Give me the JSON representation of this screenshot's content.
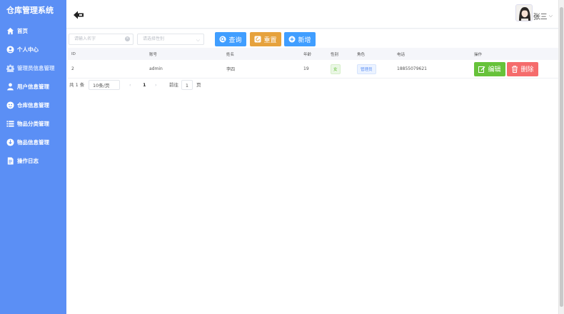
{
  "app": {
    "title": "仓库管理系统"
  },
  "sidebar": {
    "items": [
      {
        "label": "首页",
        "icon": "home-icon"
      },
      {
        "label": "个人中心",
        "icon": "user-circle-icon"
      },
      {
        "label": "管理员信息管理",
        "icon": "gear-icon"
      },
      {
        "label": "用户信息管理",
        "icon": "users-icon"
      },
      {
        "label": "仓库信息管理",
        "icon": "warehouse-icon"
      },
      {
        "label": "物品分类管理",
        "icon": "list-icon"
      },
      {
        "label": "物品信息管理",
        "icon": "box-icon"
      },
      {
        "label": "操作日志",
        "icon": "log-icon"
      }
    ]
  },
  "header": {
    "user_name": "张三",
    "caret": "⌵"
  },
  "search": {
    "name_placeholder": "请输入名字",
    "gender_placeholder": "请选择性别",
    "query_label": "查询",
    "reset_label": "重置",
    "add_label": "新增"
  },
  "table": {
    "columns": [
      "ID",
      "账号",
      "姓名",
      "年龄",
      "性别",
      "角色",
      "电话",
      "操作"
    ],
    "rows": [
      {
        "id": "2",
        "account": "admin",
        "name": "李四",
        "age": "19",
        "gender": "女",
        "role": "管理员",
        "phone": "18855079621"
      }
    ],
    "edit_label": "编辑",
    "delete_label": "删除"
  },
  "pagination": {
    "total_text": "共 1 条",
    "page_size": "10条/页",
    "prev": "‹",
    "current_page": "1",
    "next": "›",
    "goto_label": "前往",
    "goto_value": "1",
    "page_suffix": "页"
  },
  "colors": {
    "sidebar": "#5b8ff5",
    "primary": "#409eff",
    "warning": "#e6a23c",
    "success": "#67c23a",
    "danger": "#f56c6c"
  }
}
